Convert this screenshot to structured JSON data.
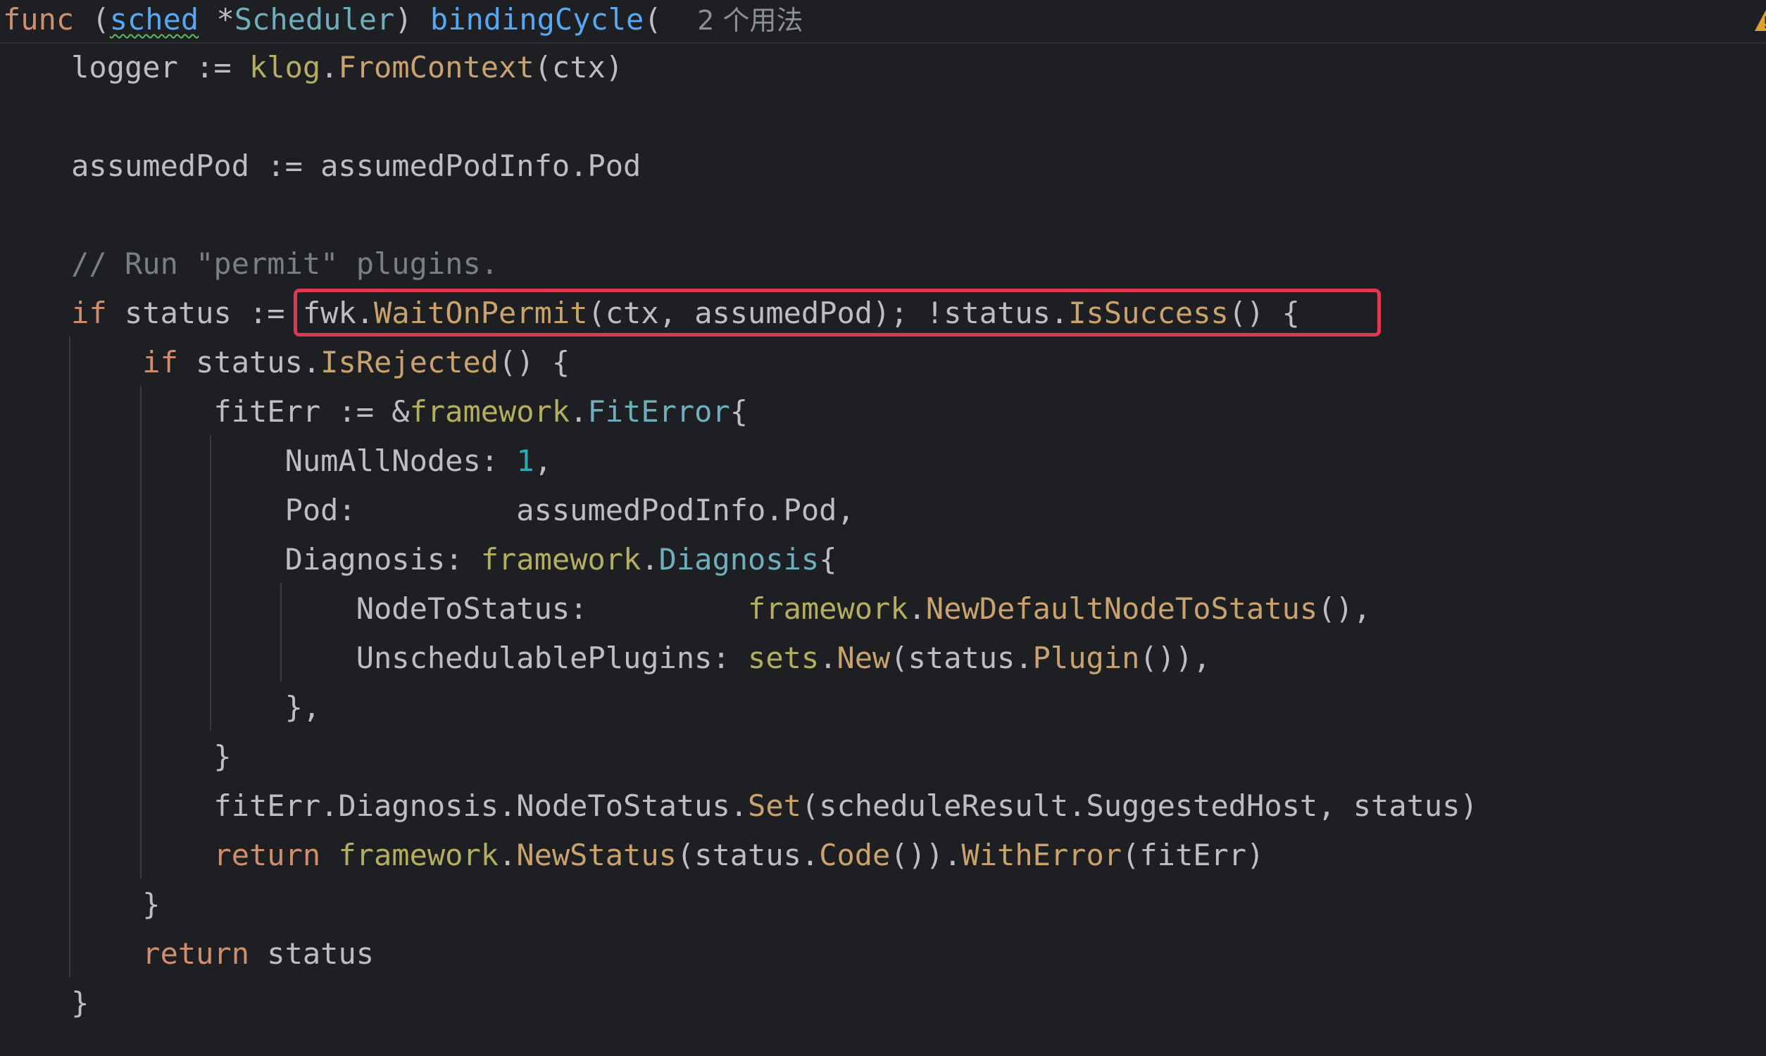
{
  "header": {
    "func_kw": "func",
    "open_paren": " (",
    "receiver": "sched",
    "star": " *",
    "receiver_type": "Scheduler",
    "close_paren": ") ",
    "func_name": "bindingCycle",
    "after_name": "(  ",
    "usage_hint": "2 个用法"
  },
  "code": {
    "l1": {
      "a": "    logger := ",
      "b": "klog",
      "c": ".",
      "d": "FromContext",
      "e": "(ctx)"
    },
    "l2": {
      "a": "    assumedPod := assumedPodInfo.Pod"
    },
    "l3": {
      "a": "    // Run \"permit\" plugins."
    },
    "l4": {
      "a": "    ",
      "b": "if",
      "c": " status := ",
      "d": "fwk",
      "e": ".",
      "f": "WaitOnPermit",
      "g": "(ctx, assumedPod); !status.",
      "h": "IsSuccess",
      "i": "() {"
    },
    "l5": {
      "a": "        ",
      "b": "if",
      "c": " status.",
      "d": "IsRejected",
      "e": "() {"
    },
    "l6": {
      "a": "            fitErr := &",
      "b": "framework",
      "c": ".",
      "d": "FitError",
      "e": "{"
    },
    "l7": {
      "a": "                NumAllNodes: ",
      "b": "1",
      "c": ","
    },
    "l8": {
      "a": "                Pod:         assumedPodInfo.Pod,"
    },
    "l9": {
      "a": "                Diagnosis: ",
      "b": "framework",
      "c": ".",
      "d": "Diagnosis",
      "e": "{"
    },
    "l10": {
      "a": "                    NodeToStatus:         ",
      "b": "framework",
      "c": ".",
      "d": "NewDefaultNodeToStatus",
      "e": "(),"
    },
    "l11": {
      "a": "                    UnschedulablePlugins: ",
      "b": "sets",
      "c": ".",
      "d": "New",
      "e": "(status.",
      "f": "Plugin",
      "g": "()),"
    },
    "l12": {
      "a": "                },"
    },
    "l13": {
      "a": "            }"
    },
    "l14": {
      "a": "            fitErr.Diagnosis.NodeToStatus.",
      "b": "Set",
      "c": "(scheduleResult.SuggestedHost, status)"
    },
    "l15": {
      "a": "            ",
      "b": "return",
      "c": " ",
      "d": "framework",
      "e": ".",
      "f": "NewStatus",
      "g": "(status.",
      "h": "Code",
      "i": "()).",
      "j": "WithError",
      "k": "(fitErr)"
    },
    "l16": {
      "a": "        }"
    },
    "l17": {
      "a": "        ",
      "b": "return",
      "c": " status"
    },
    "l18": {
      "a": "    }"
    }
  },
  "colors": {
    "background": "#1e1f22",
    "keyword": "#cf8e6d",
    "function_decl": "#56a8f5",
    "type": "#6fafbd",
    "method_call": "#c9a26d",
    "package": "#b3ae60",
    "number": "#2aacb8",
    "comment": "#7a7e85",
    "highlight_box": "#e0394f",
    "warning": "#e0a030"
  },
  "icons": {
    "warning": "warning-icon"
  }
}
